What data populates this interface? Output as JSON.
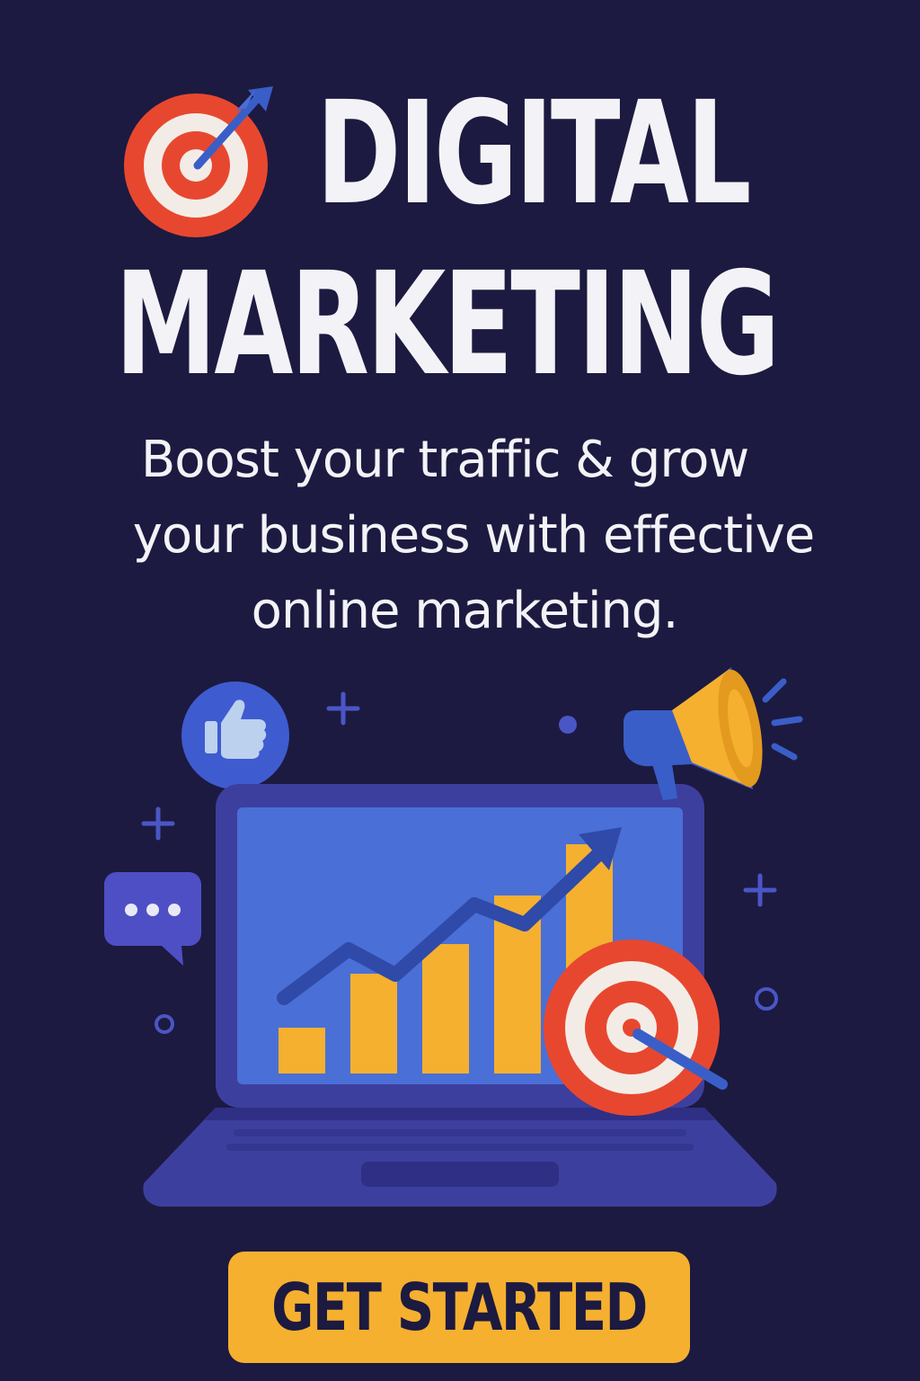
{
  "title": {
    "line1": "DIGITAL",
    "line2": "MARKETING"
  },
  "tagline": {
    "line1": "Boost your traffic & grow",
    "line2": "your business with effective",
    "line3": "online marketing."
  },
  "cta": {
    "label": "GET STARTED"
  },
  "illustration": {
    "chart_bar_levels": [
      0.17,
      0.37,
      0.48,
      0.66,
      0.85
    ],
    "icons": [
      "target-icon",
      "thumbs-up-icon",
      "megaphone-icon",
      "chat-bubble-icon",
      "laptop-icon",
      "trend-arrow-icon",
      "target-with-dart-icon"
    ]
  },
  "colors": {
    "background": "#1c1a40",
    "text": "#f3f2f6",
    "accent_yellow": "#f5b030",
    "accent_red": "#e8472f",
    "accent_blue": "#4a6fd6",
    "laptop_body": "#3d3f9e"
  }
}
